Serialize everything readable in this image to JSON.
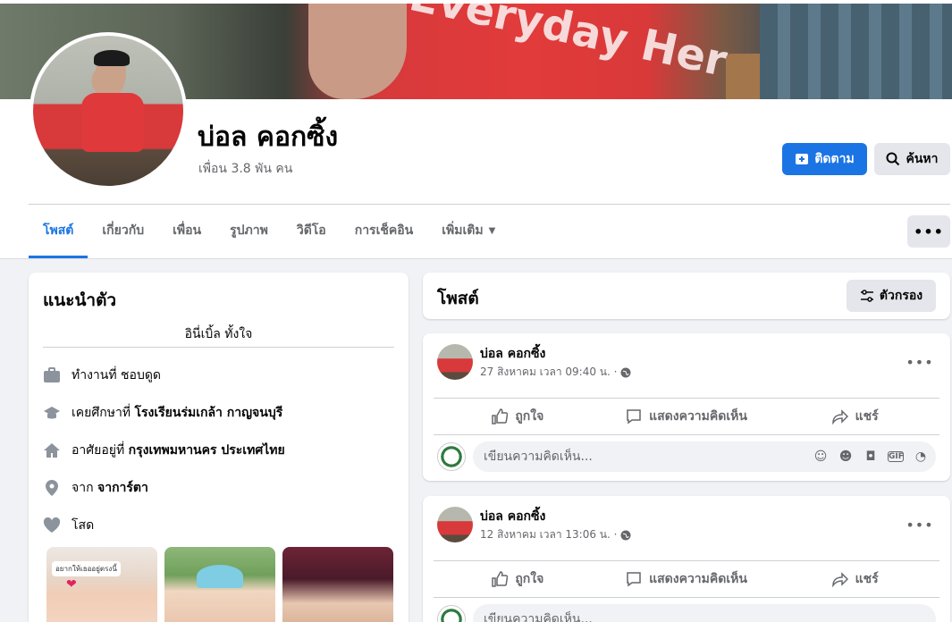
{
  "profile": {
    "name": "บ่อล คอกซิ้ง",
    "friends": "เพื่อน 3.8 พัน คน",
    "cover_text": "Everyday Her"
  },
  "header_buttons": {
    "follow": "ติดตาม",
    "search": "ค้นหา",
    "more": "•••"
  },
  "tabs": [
    {
      "label": "โพสต์",
      "active": true
    },
    {
      "label": "เกี่ยวกับ"
    },
    {
      "label": "เพื่อน"
    },
    {
      "label": "รูปภาพ"
    },
    {
      "label": "วิดีโอ"
    },
    {
      "label": "การเช็คอิน"
    },
    {
      "label": "เพิ่มเติม"
    }
  ],
  "intro": {
    "title": "แนะนำตัว",
    "bio": "อินี่เบิ้ล ทั้งใจ",
    "rows": [
      {
        "icon": "briefcase-icon",
        "prefix": "ทำงานที่ ชอบดูด",
        "bold": ""
      },
      {
        "icon": "graduation-cap-icon",
        "prefix": "เคยศึกษาที่ ",
        "bold": "โรงเรียนร่มเกล้า กาญจนบุรี"
      },
      {
        "icon": "home-icon",
        "prefix": "อาศัยอยู่ที่ ",
        "bold": "กรุงเทพมหานคร ประเทศไทย"
      },
      {
        "icon": "location-pin-icon",
        "prefix": "จาก ",
        "bold": "จาการ์ตา"
      },
      {
        "icon": "heart-icon",
        "prefix": "โสด",
        "bold": ""
      }
    ],
    "photo_caption": "อยากให้เธออยู่ตรงนี้"
  },
  "posts_header": {
    "title": "โพสต์",
    "filter": "ตัวกรอง"
  },
  "posts": [
    {
      "author": "บ่อล คอกซิ้ง",
      "time": "27 สิงหาคม เวลา 09:40 น. ·"
    },
    {
      "author": "บ่อล คอกซิ้ง",
      "time": "12 สิงหาคม เวลา 13:06 น. ·"
    }
  ],
  "post_actions": {
    "like": "ถูกใจ",
    "comment": "แสดงความคิดเห็น",
    "share": "แชร์",
    "comment_placeholder": "เขียนความคิดเห็น..."
  },
  "colors": {
    "accent": "#1b74e4",
    "page_bg": "#f0f2f5",
    "secondary_text": "#65676b"
  }
}
